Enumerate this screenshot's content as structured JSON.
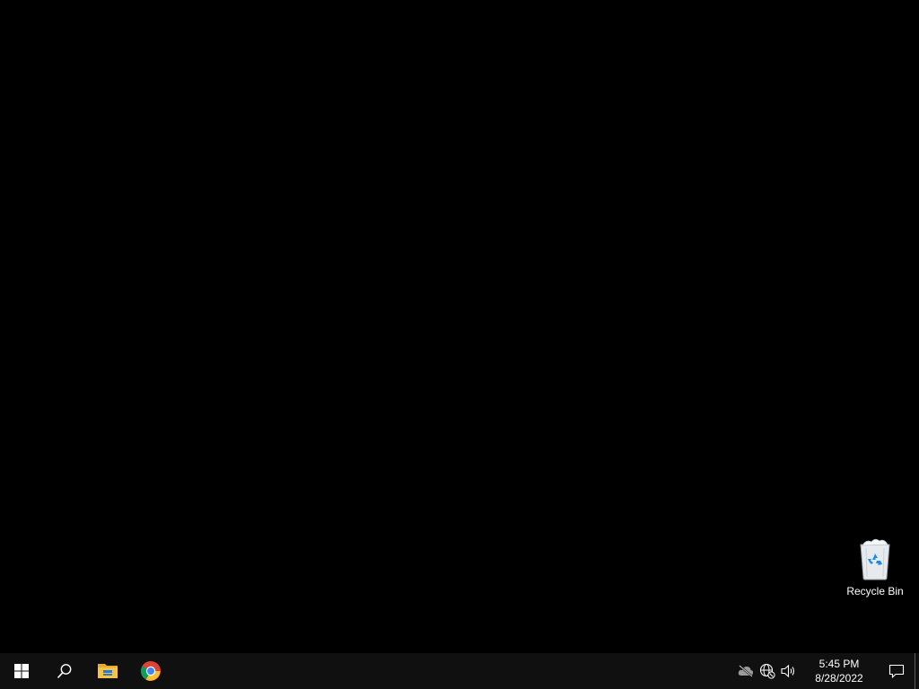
{
  "desktop": {
    "background_color": "#000000",
    "icons": [
      {
        "label": "Recycle Bin",
        "icon": "recycle-bin-icon"
      }
    ]
  },
  "taskbar": {
    "background_color": "#101010",
    "buttons": [
      {
        "name": "start",
        "icon": "windows-logo-icon"
      },
      {
        "name": "search",
        "icon": "search-icon"
      },
      {
        "name": "file-explorer",
        "icon": "folder-icon"
      },
      {
        "name": "chrome",
        "icon": "chrome-icon"
      }
    ],
    "tray": {
      "icons": [
        "cloud-offline-icon",
        "network-globe-icon",
        "volume-icon"
      ],
      "time": "5:45 PM",
      "date": "8/28/2022",
      "notification_icon": "notification-icon"
    }
  }
}
